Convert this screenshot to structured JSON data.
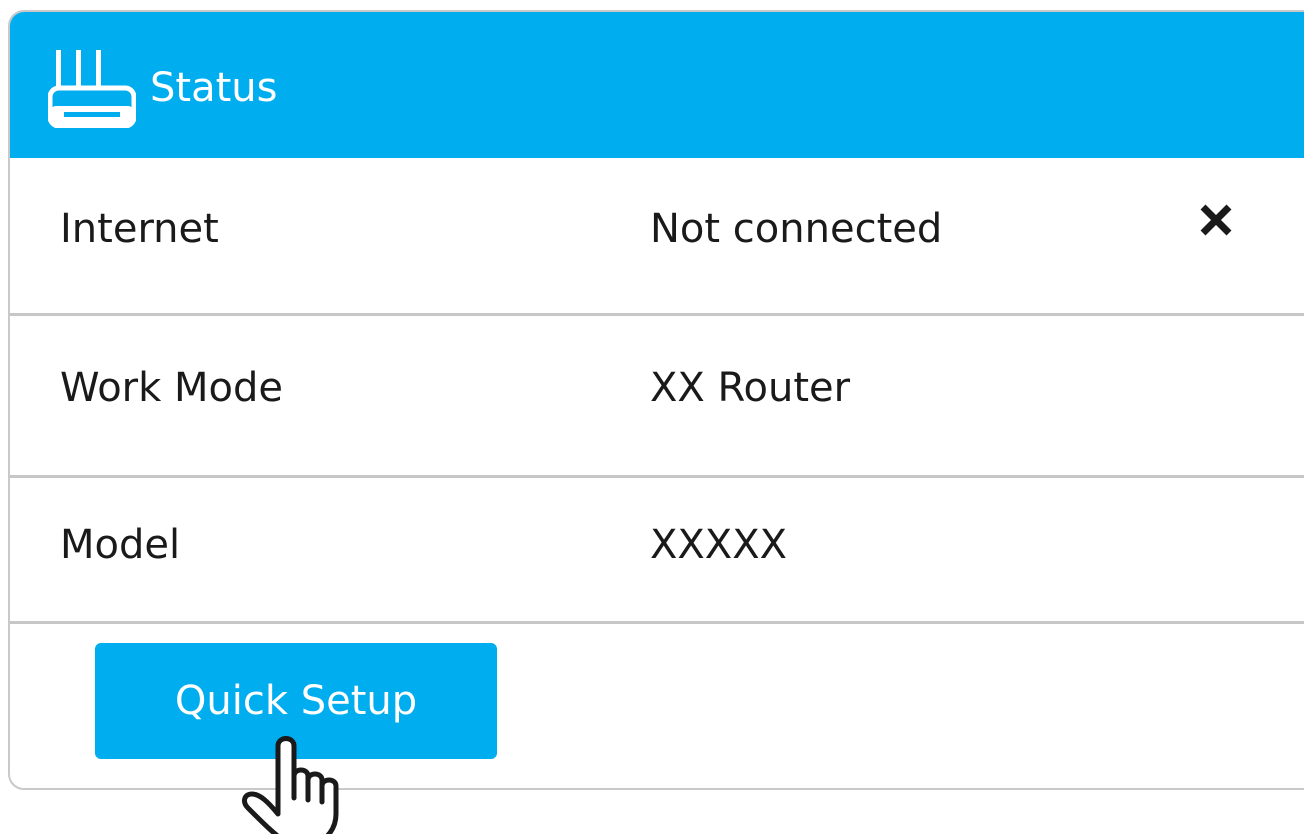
{
  "header": {
    "icon": "router-icon",
    "title": "Status"
  },
  "rows": [
    {
      "label": "Internet",
      "value": "Not connected",
      "status_icon": "close-icon"
    },
    {
      "label": "Work Mode",
      "value": "XX Router"
    },
    {
      "label": "Model",
      "value": "XXXXX"
    }
  ],
  "actions": {
    "quick_setup_label": "Quick Setup",
    "cursor_icon": "hand-pointer-icon"
  },
  "colors": {
    "accent": "#00adef",
    "text": "#1a1a1a",
    "divider": "#c7c7c7",
    "border": "#c9c9c9"
  }
}
